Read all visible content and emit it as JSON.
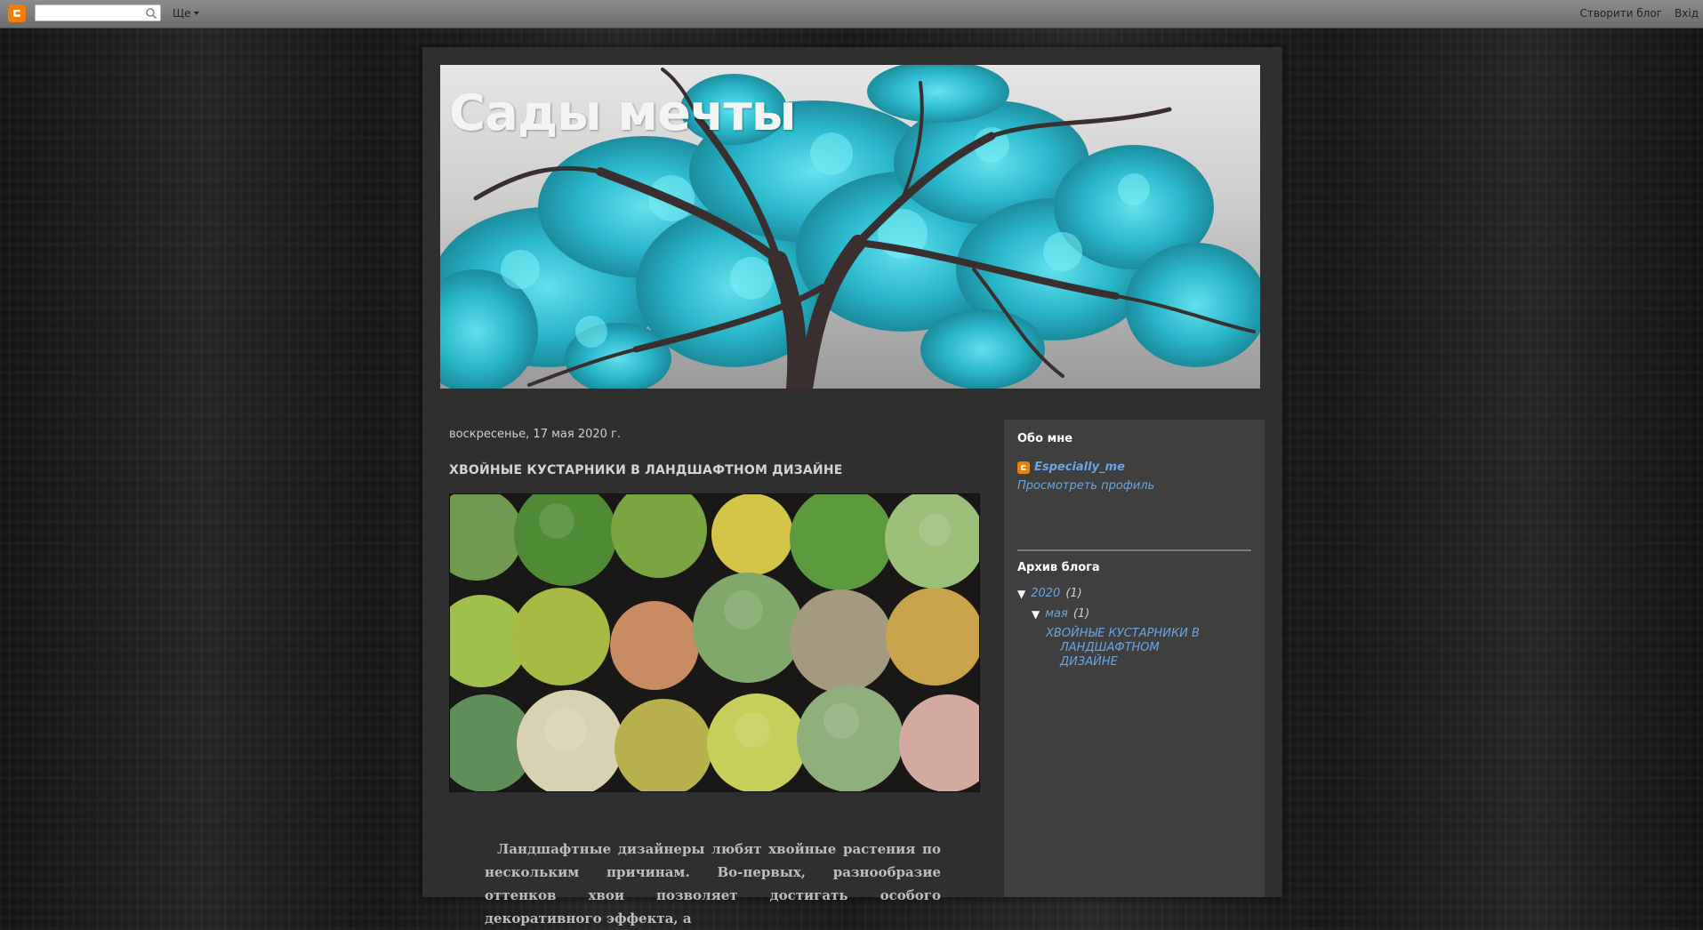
{
  "navbar": {
    "logo_icon": "blogger-icon",
    "search_placeholder": "",
    "search_icon": "search-icon",
    "more_label": "Ще",
    "create_blog_label": "Створити блог",
    "login_label": "Вхід"
  },
  "header": {
    "title": "Сады мечты"
  },
  "post": {
    "date": "воскресенье, 17 мая 2020 г.",
    "title": "ХВОЙНЫЕ КУСТАРНИКИ В ЛАНДШАФТНОМ ДИЗАЙНЕ",
    "body": "Ландшафтные дизайнеры любят хвойные растения по нескольким причинам. Во-первых, разнообразие оттенков хвои позволяет достигать особого декоративного эффекта, а"
  },
  "sidebar": {
    "about_title": "Обо мне",
    "profile_icon": "blogger-icon",
    "profile_name": "Especially_me",
    "view_profile": "Просмотреть профиль",
    "archive_title": "Архив блога",
    "archive": {
      "year": "2020",
      "year_count": "(1)",
      "month": "мая",
      "month_count": "(1)",
      "toggle": "▼",
      "post_title": "ХВОЙНЫЕ КУСТАРНИКИ В ЛАНДШАФТНОМ ДИЗАЙНЕ"
    }
  },
  "colors": {
    "accent_link": "#6aa5e5",
    "archive_post_link": "#e0801f",
    "blogger_orange": "#f57d00",
    "tree_foliage": "#2ec4d6"
  }
}
